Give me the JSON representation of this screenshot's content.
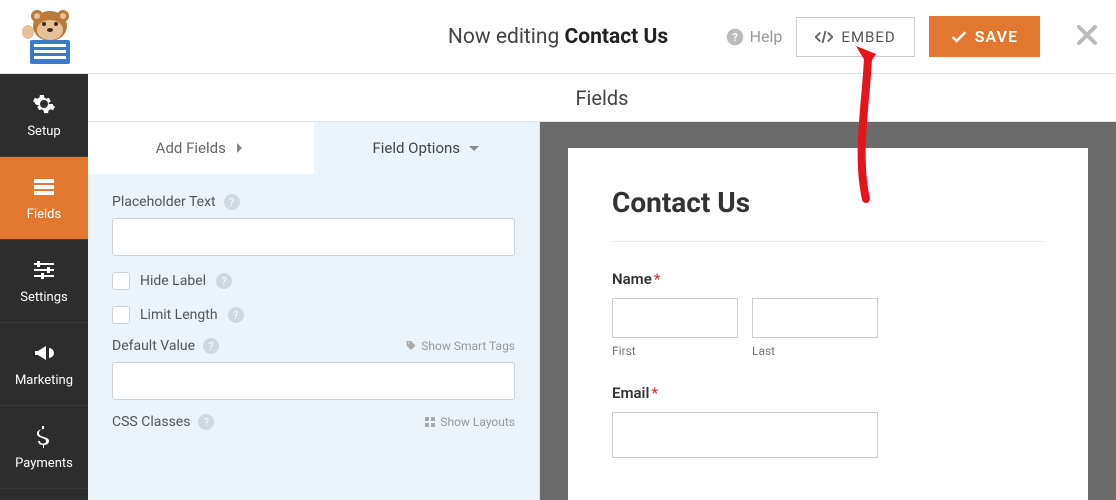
{
  "header": {
    "editing_prefix": "Now editing ",
    "editing_title": "Contact Us",
    "help_label": "Help",
    "embed_label": "EMBED",
    "save_label": "SAVE"
  },
  "sidebar": {
    "items": [
      {
        "label": "Setup"
      },
      {
        "label": "Fields"
      },
      {
        "label": "Settings"
      },
      {
        "label": "Marketing"
      },
      {
        "label": "Payments"
      }
    ]
  },
  "section_title": "Fields",
  "tabs": {
    "add": "Add Fields",
    "options": "Field Options"
  },
  "options": {
    "placeholder_label": "Placeholder Text",
    "placeholder_value": "",
    "hide_label": "Hide Label",
    "limit_length": "Limit Length",
    "default_value_label": "Default Value",
    "default_value": "",
    "smart_tags": "Show Smart Tags",
    "css_classes_label": "CSS Classes",
    "show_layouts": "Show Layouts"
  },
  "preview": {
    "title": "Contact Us",
    "name_label": "Name",
    "first_label": "First",
    "last_label": "Last",
    "email_label": "Email",
    "required_marker": "*"
  }
}
